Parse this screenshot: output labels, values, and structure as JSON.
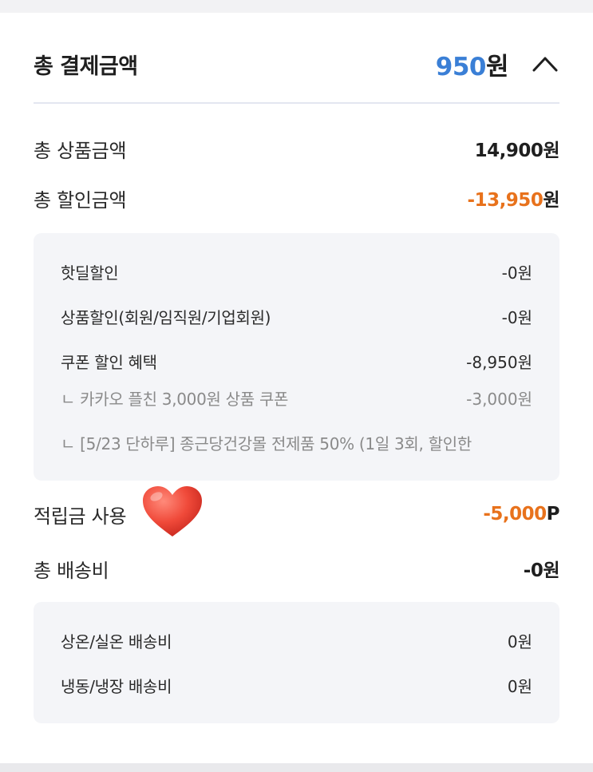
{
  "header": {
    "title": "총 결제금액",
    "amount_number": "950",
    "amount_unit": "원"
  },
  "summary": {
    "product_total": {
      "label": "총 상품금액",
      "value": "14,900원"
    },
    "discount_total": {
      "label": "총 할인금액",
      "value_number": "-13,950",
      "value_unit": "원"
    }
  },
  "discount_details": [
    {
      "label": "핫딜할인",
      "value": "-0원"
    },
    {
      "label": "상품할인(회원/임직원/기업회원)",
      "value": "-0원"
    },
    {
      "label": "쿠폰 할인 혜택",
      "value": "-8,950원"
    },
    {
      "label": "ㄴ 카카오 플친 3,000원 상품 쿠폰",
      "value": "-3,000원"
    },
    {
      "label": "ㄴ [5/23 단하루] 종근당건강몰 전제품 50% (1일 3회, 할인한",
      "value": ""
    }
  ],
  "points": {
    "label": "적립금 사용",
    "value_number": "-5,000",
    "value_unit": "P"
  },
  "shipping": {
    "label": "총 배송비",
    "value": "-0원"
  },
  "shipping_details": [
    {
      "label": "상온/실온 배송비",
      "value": "0원"
    },
    {
      "label": "냉동/냉장 배송비",
      "value": "0원"
    }
  ],
  "colors": {
    "accent_blue": "#3a7fd6",
    "accent_orange": "#e8721c",
    "heart": "#f04a3a"
  },
  "icons": {
    "collapse": "chevron-up-icon",
    "sticker": "heart-icon"
  }
}
